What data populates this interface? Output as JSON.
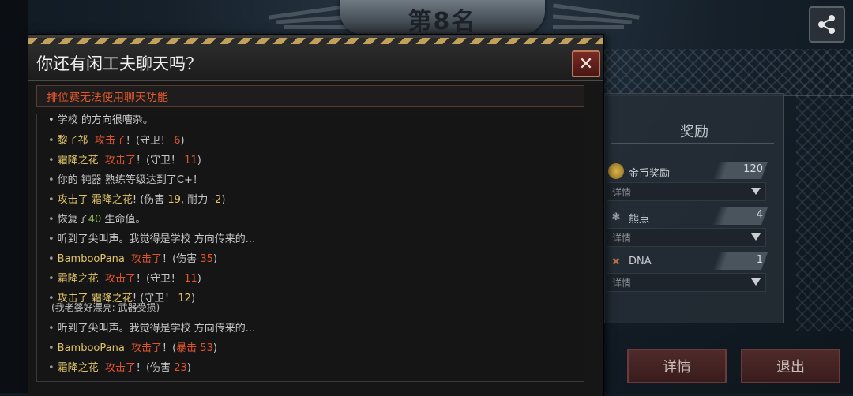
{
  "rank": {
    "title": "第8名"
  },
  "reward": {
    "title": "奖励",
    "rows": [
      {
        "name": "金币奖励",
        "value": "120",
        "detail": "详情",
        "icon": "coin-icon"
      },
      {
        "name": "熊点",
        "value": "4",
        "detail": "详情",
        "icon": "bear-points-icon"
      },
      {
        "name": "DNA",
        "value": "1",
        "detail": "详情",
        "icon": "dna-icon"
      }
    ]
  },
  "buttons": {
    "detail": "详情",
    "exit": "退出"
  },
  "dialog": {
    "title": "你还有闲工夫聊天吗？",
    "close": "✕",
    "notice": "排位赛无法使用聊天功能"
  },
  "chat": {
    "partial_top": "• 学校 的方向很嘈杂。",
    "lines": [
      {
        "p1": "黎了祁",
        "p2": "攻击了",
        "p3": "！(守卫！",
        "p4": "6",
        "p5": ")"
      },
      {
        "p1": "霜降之花",
        "p2": "攻击了",
        "p3": "！(守卫！",
        "p4": "11",
        "p5": ")"
      },
      {
        "text": "你的 钝器 熟练等级达到了C+！"
      },
      {
        "a1": "攻击了",
        "a2": "霜降之花",
        "a3": "! (伤害",
        "a4": "19",
        "a5": ", 耐力",
        "a6": "-2",
        "a7": ")"
      },
      {
        "h1": "恢复了",
        "h2": "40",
        "h3": "生命值。"
      },
      {
        "text": "听到了尖叫声。我觉得是学校 方向传来的..."
      },
      {
        "p1": "BambooPana",
        "p2": "攻击了",
        "p3": "！(伤害",
        "p4": "35",
        "p5": ")"
      },
      {
        "p1": "霜降之花",
        "p2": "攻击了",
        "p3": "！(守卫！",
        "p4": "11",
        "p5": ")"
      },
      {
        "a1": "攻击了",
        "a2": "霜降之花",
        "a3": "! (守卫！",
        "a4": "12",
        "a5": ")"
      },
      {
        "text": "(我老婆好漂亮: 武器受损)"
      },
      {
        "text": "听到了尖叫声。我觉得是学校 方向传来的..."
      },
      {
        "p1": "BambooPana",
        "p2": "攻击了",
        "p3": "！(",
        "p4": "暴击 53",
        "p5": ")"
      },
      {
        "p1": "霜降之花",
        "p2": "攻击了",
        "p3": "！(伤害",
        "p4": "23",
        "p5": ")"
      }
    ]
  },
  "colors": {
    "player": "#e0c46a",
    "attack": "#e0532d",
    "heal": "#8fc04a",
    "notice": "#e2582c"
  }
}
